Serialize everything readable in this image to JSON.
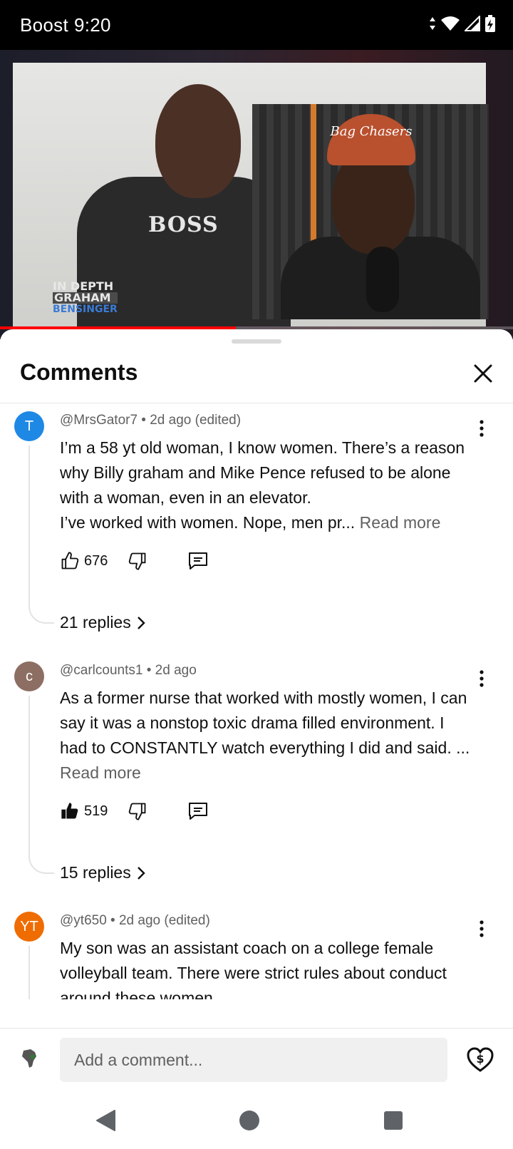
{
  "status_bar": {
    "carrier": "Boost",
    "time": "9:20"
  },
  "video": {
    "shirt_text": "BOSS",
    "badge_line1": "IN DEPTH",
    "badge_line2": "GRAHAM",
    "badge_line3": "BENSINGER",
    "cap_text": "Bag Chasers",
    "progress": 0.46
  },
  "comments_sheet": {
    "title": "Comments",
    "comments": [
      {
        "avatar_letter": "T",
        "avatar_color": "#1e88e5",
        "author": "@MrsGator7",
        "meta_suffix": " • 2d ago (edited)",
        "text": "I’m a 58 yt old woman, I know women.  There’s a reason why Billy graham and Mike Pence refused to be alone with a woman, even in an elevator.\nI’ve worked with women. Nope, men pr... ",
        "read_more": "Read more",
        "likes": "676",
        "liked": false,
        "replies": "21 replies"
      },
      {
        "avatar_letter": "c",
        "avatar_color": "#8d6e63",
        "author": "@carlcounts1",
        "meta_suffix": " • 2d ago",
        "text": "As a former nurse that worked with mostly women, I can say it was a nonstop toxic drama filled environment. I had to CONSTANTLY watch everything I did and said. ... ",
        "read_more": "Read more",
        "likes": "519",
        "liked": true,
        "replies": "15 replies"
      },
      {
        "avatar_letter": "YT",
        "avatar_color": "#ef6c00",
        "author": "@yt650",
        "meta_suffix": " • 2d ago (edited)",
        "text": "My son was an assistant coach on a college female volleyball team.  There were strict rules about conduct around these women."
      }
    ]
  },
  "composer": {
    "placeholder": "Add a comment..."
  },
  "icons": {
    "close": "close-icon",
    "more": "more-vert-icon",
    "like": "thumbs-up-icon",
    "dislike": "thumbs-down-icon",
    "reply": "reply-comment-icon",
    "chevron": "chevron-right-icon",
    "super_thanks": "heart-dollar-icon"
  }
}
